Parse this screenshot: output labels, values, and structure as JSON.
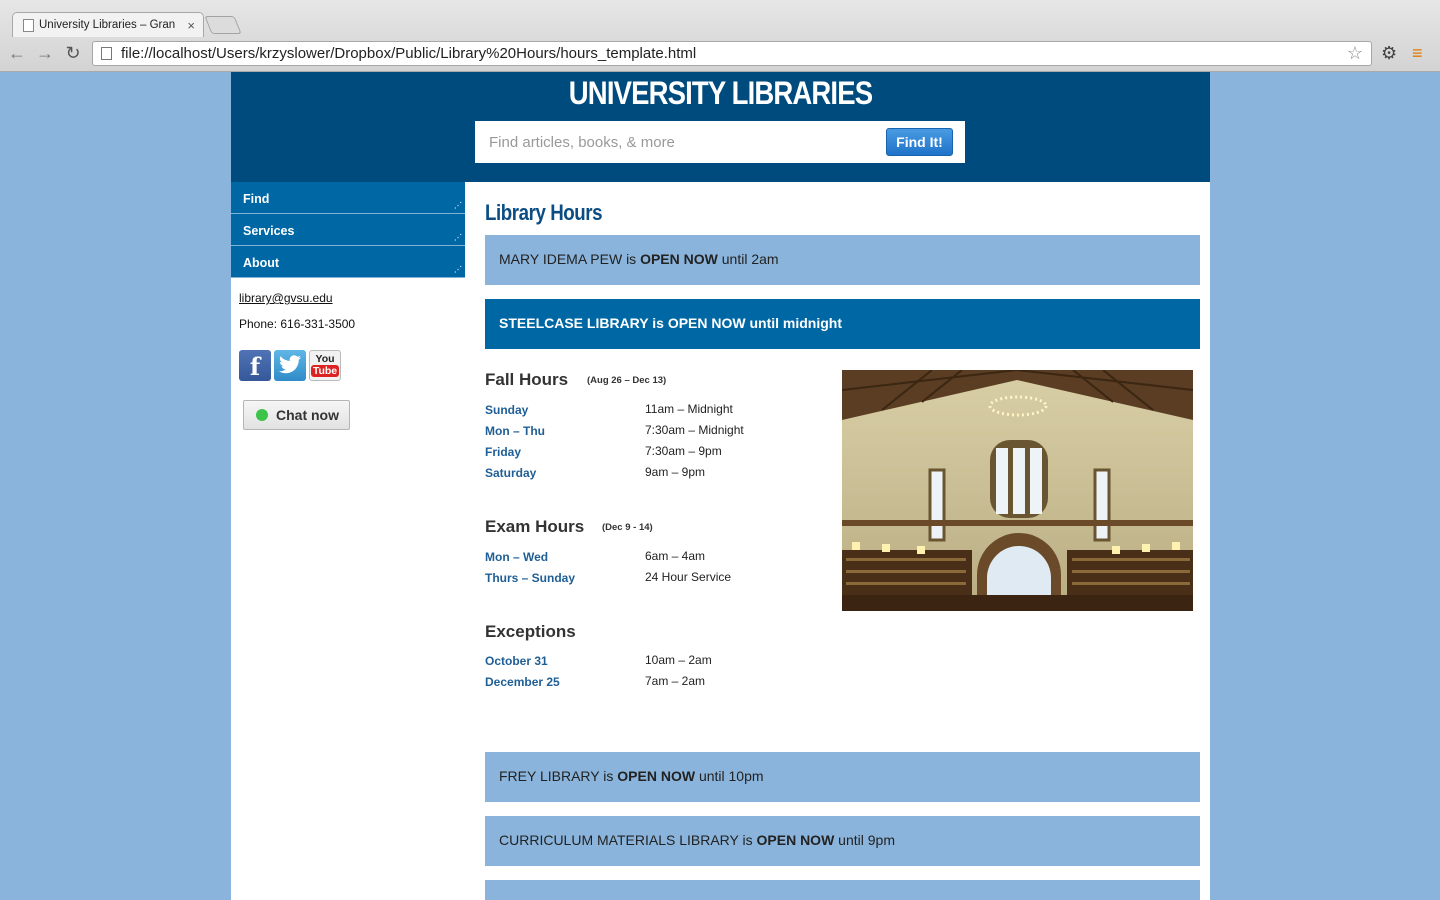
{
  "browser": {
    "tab_title": "University Libraries – Gran",
    "tab_close": "×",
    "url": "file://localhost/Users/krzyslower/Dropbox/Public/Library%20Hours/hours_template.html",
    "back_icon": "←",
    "forward_icon": "→",
    "reload_icon": "↻",
    "star_icon": "☆",
    "settings_icon": "⚙",
    "menu_icon": "≡"
  },
  "header": {
    "site_title": "UNIVERSITY LIBRARIES",
    "search_placeholder": "Find articles, books, & more",
    "search_button": "Find It!"
  },
  "sidebar": {
    "nav": [
      {
        "label": "Find"
      },
      {
        "label": "Services"
      },
      {
        "label": "About"
      }
    ],
    "email": "library@gvsu.edu",
    "phone": "Phone: 616-331-3500",
    "social": {
      "facebook": "f",
      "youtube_you": "You",
      "youtube_tube": "Tube"
    },
    "chat_label": "Chat now"
  },
  "main": {
    "title": "Library Hours",
    "libraries_top": [
      {
        "name": "MARY IDEMA PEW is ",
        "status": "OPEN NOW",
        "until": " until 2am"
      },
      {
        "name": "STEELCASE LIBRARY is ",
        "status": "OPEN NOW",
        "until": " until midnight"
      }
    ],
    "fall": {
      "title": "Fall Hours",
      "dates": "(Aug 26 – Dec 13)",
      "rows": [
        {
          "day": "Sunday",
          "time": "11am – Midnight"
        },
        {
          "day": "Mon – Thu",
          "time": "7:30am – Midnight"
        },
        {
          "day": "Friday",
          "time": "7:30am – 9pm"
        },
        {
          "day": "Saturday",
          "time": "9am – 9pm"
        }
      ]
    },
    "exam": {
      "title": "Exam Hours",
      "dates": "(Dec 9 - 14)",
      "rows": [
        {
          "day": "Mon – Wed",
          "time": "6am – 4am"
        },
        {
          "day": "Thurs – Sunday",
          "time": "24 Hour Service"
        }
      ]
    },
    "exceptions": {
      "title": "Exceptions",
      "rows": [
        {
          "day": "October 31",
          "time": "10am – 2am"
        },
        {
          "day": "December 25",
          "time": "7am – 2am"
        }
      ]
    },
    "libraries_bottom": [
      {
        "name": "FREY LIBRARY is ",
        "status": "OPEN NOW",
        "until": " until 10pm"
      },
      {
        "name": "CURRICULUM MATERIALS LIBRARY is ",
        "status": "OPEN NOW",
        "until": " until 9pm"
      }
    ]
  },
  "colors": {
    "page_bg": "#8ab4db",
    "header_bg": "#004b7d",
    "nav_bg": "#0067a5",
    "status_bg": "#8ab4db",
    "status_active_bg": "#0067a5",
    "link_blue": "#1f5f96"
  }
}
